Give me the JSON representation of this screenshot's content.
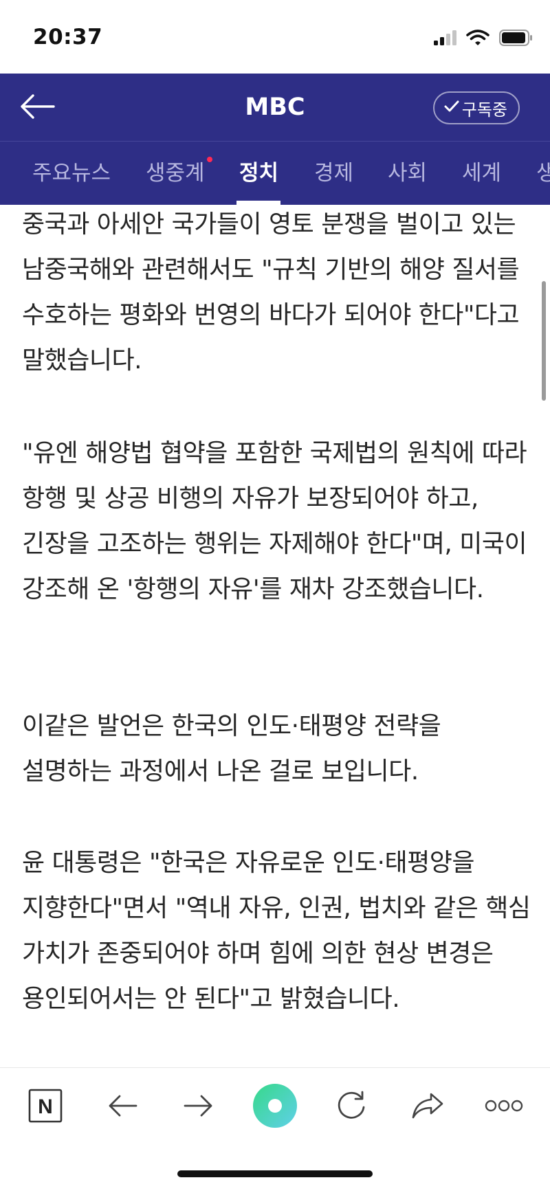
{
  "status_bar": {
    "time": "20:37"
  },
  "header": {
    "title": "MBC",
    "subscribe_label": "구독중",
    "background_color": "#2e2e86"
  },
  "tabs": [
    {
      "label": "주요뉴스",
      "active": false
    },
    {
      "label": "생중계",
      "active": false,
      "badge": true
    },
    {
      "label": "정치",
      "active": true
    },
    {
      "label": "경제",
      "active": false
    },
    {
      "label": "사회",
      "active": false
    },
    {
      "label": "세계",
      "active": false
    },
    {
      "label": "생",
      "active": false
    }
  ],
  "article": {
    "paragraphs": [
      "중국과 아세안 국가들이 영토 분쟁을 벌이고 있는 남중국해와 관련해서도 \"규칙 기반의 해양 질서를 수호하는 평화와 번영의 바다가 되어야 한다\"다고 말했습니다.",
      "\"유엔 해양법 협약을 포함한 국제법의 원칙에 따라 항행 및 상공 비행의 자유가 보장되어야 하고, 긴장을 고조하는 행위는 자제해야 한다\"며, 미국이 강조해 온 '항행의 자유'를 재차 강조했습니다.",
      "이같은 발언은 한국의 인도·태평양 전략을 설명하는 과정에서 나온 걸로 보입니다.",
      "윤 대통령은 \"한국은 자유로운 인도·태평양을 지향한다\"면서 \"역내 자유, 인권, 법치와 같은 핵심 가치가 존중되어야 하며 힘에 의한 현상 변경은 용인되어서는 안 된다\"고 밝혔습니다."
    ]
  },
  "toolbar": {
    "items": [
      {
        "icon": "naver-n-icon",
        "glyph": "N"
      },
      {
        "icon": "back-arrow-icon"
      },
      {
        "icon": "forward-arrow-icon"
      },
      {
        "icon": "green-dot-icon"
      },
      {
        "icon": "refresh-icon"
      },
      {
        "icon": "share-icon"
      },
      {
        "icon": "more-icon"
      }
    ]
  }
}
